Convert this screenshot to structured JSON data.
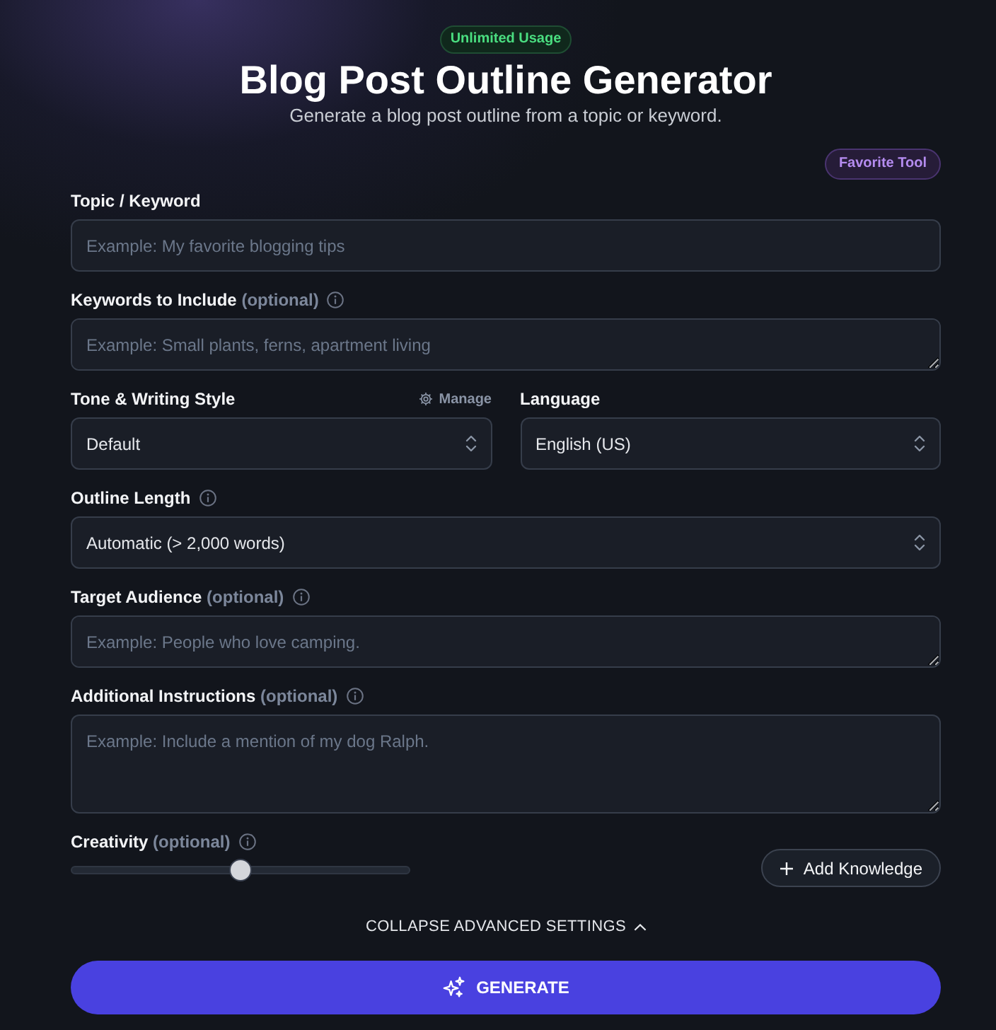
{
  "header": {
    "badge": "Unlimited Usage",
    "title": "Blog Post Outline Generator",
    "subtitle": "Generate a blog post outline from a topic or keyword.",
    "favorite": "Favorite Tool"
  },
  "rows": [
    {
      "fields": [
        {
          "kind": "input",
          "label": "Topic / Keyword",
          "info": false,
          "placeholder": "Example: My favorite blogging tips"
        }
      ]
    },
    {
      "fields": [
        {
          "kind": "textarea",
          "label": "Keywords to Include",
          "optional": "(optional)",
          "info": true,
          "placeholder": "Example: Small plants, ferns, apartment living"
        }
      ]
    },
    {
      "fields": [
        {
          "kind": "select",
          "label": "Tone & Writing Style",
          "info": false,
          "action": "Manage",
          "value": "Default"
        },
        {
          "kind": "select",
          "label": "Language",
          "info": false,
          "value": "English (US)"
        }
      ]
    },
    {
      "fields": [
        {
          "kind": "select",
          "label": "Outline Length",
          "info": true,
          "value": "Automatic (> 2,000 words)"
        }
      ]
    },
    {
      "fields": [
        {
          "kind": "textarea",
          "label": "Target Audience",
          "optional": "(optional)",
          "info": true,
          "placeholder": "Example: People who love camping."
        }
      ]
    },
    {
      "fields": [
        {
          "kind": "longtext",
          "label": "Additional Instructions",
          "optional": "(optional)",
          "info": true,
          "placeholder": "Example: Include a mention of my dog Ralph."
        }
      ]
    }
  ],
  "creativity": {
    "label": "Creativity",
    "optional": "(optional)",
    "info": true,
    "level": 0.5
  },
  "add_knowledge": "Add Knowledge",
  "advanced_toggle": {
    "label": "COLLAPSE ADVANCED SETTINGS",
    "expanded": true
  },
  "generate": "GENERATE"
}
